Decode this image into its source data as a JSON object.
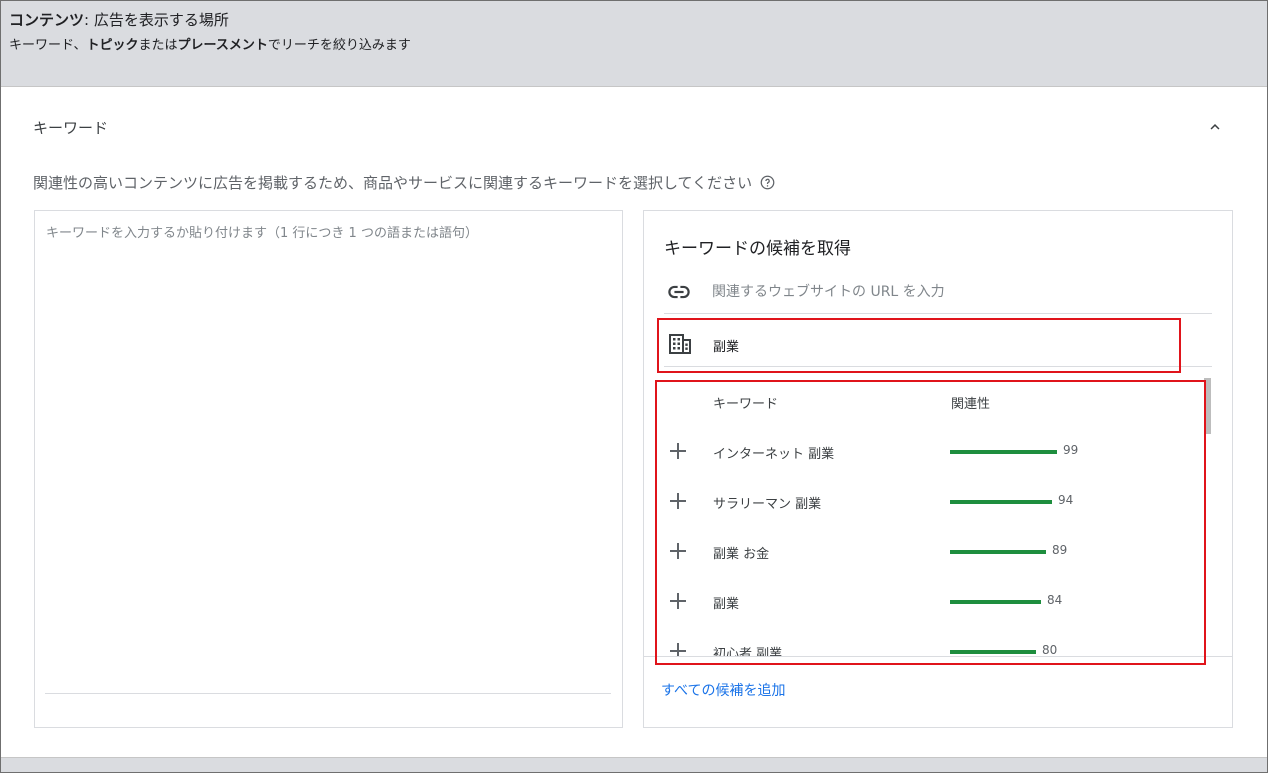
{
  "header": {
    "line1_bold": "コンテンツ",
    "line1_rest": ": 広告を表示する場所",
    "line2": {
      "part1": "キーワード",
      "sep1": "、",
      "part2": "トピック",
      "sep2": "または",
      "part3": "プレースメント",
      "tail": "でリーチを絞り込みます"
    }
  },
  "section": {
    "title": "キーワード",
    "description": "関連性の高いコンテンツに広告を掲載するため、商品やサービスに関連するキーワードを選択してください"
  },
  "keyword_input": {
    "placeholder": "キーワードを入力するか貼り付けます（1 行につき 1 つの語または語句）"
  },
  "suggestions": {
    "title": "キーワードの候補を取得",
    "url_placeholder": "関連するウェブサイトの URL を入力",
    "product_value": "副業",
    "columns": {
      "keyword": "キーワード",
      "relevance": "関連性"
    },
    "items": [
      {
        "keyword": "インターネット 副業",
        "relevance": 99
      },
      {
        "keyword": "サラリーマン 副業",
        "relevance": 94
      },
      {
        "keyword": "副業 お金",
        "relevance": 89
      },
      {
        "keyword": "副業",
        "relevance": 84
      },
      {
        "keyword": "初心者 副業",
        "relevance": 80
      }
    ],
    "add_all": "すべての候補を追加"
  },
  "colors": {
    "relevance_bar": "#1e8e3e",
    "highlight": "#e0141b",
    "link": "#1a73e8",
    "header_bg": "#dadce0"
  },
  "icons": [
    "chevron-up-icon",
    "help-icon",
    "link-icon",
    "building-icon",
    "plus-icon"
  ]
}
